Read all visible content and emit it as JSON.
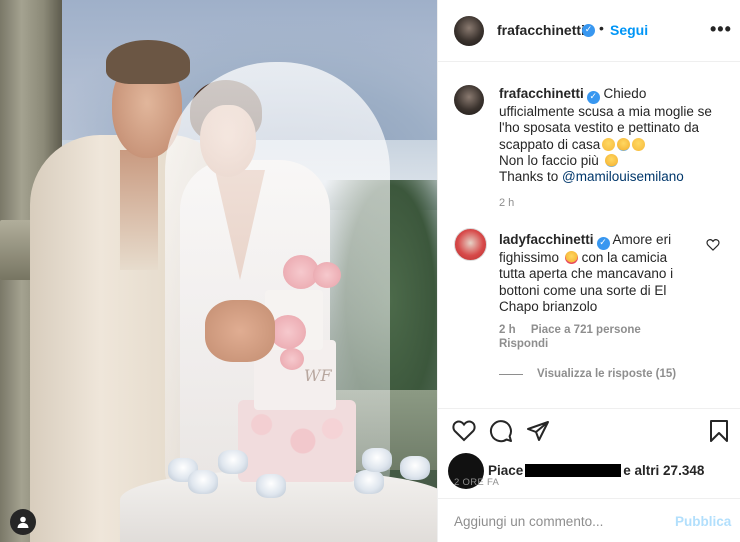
{
  "post": {
    "author": "frafacchinetti",
    "follow_label": "Segui",
    "header_separator": "•",
    "more_label": "•••",
    "image_monogram": "WF"
  },
  "caption": {
    "username": "frafacchinetti",
    "lines": [
      "Chiedo",
      "ufficialmente scusa a mia moglie se",
      "l'ho sposata vestito e pettinato da",
      "scappato di casa",
      "Non lo faccio più",
      "Thanks to"
    ],
    "mention": "@mamilouisemilano",
    "time": "2 h"
  },
  "reply": {
    "username": "ladyfacchinetti",
    "text_1": "Amore eri",
    "text_2": "fighissimo",
    "text_2b": "con la camicia",
    "text_3": "tutta aperta che mancavano i",
    "text_4": "bottoni come una sorte di El",
    "text_5": "Chapo brianzolo",
    "time": "2 h",
    "likes": "Piace a 721 persone",
    "reply_label": "Rispondi",
    "view_replies": "Visualizza le risposte (15)"
  },
  "actions": {
    "likes_prefix": "Piace",
    "likes_suffix": "e altri 27.348",
    "post_time": "2 ORE FA"
  },
  "comment_box": {
    "placeholder": "Aggiungi un commento...",
    "publish_label": "Pubblica"
  },
  "colors": {
    "accent": "#0095f6",
    "verified": "#3897f0",
    "publish_disabled": "#b2dffc",
    "muted": "#8e8e8e"
  },
  "icons": [
    "verified-badge-icon",
    "more-options-icon",
    "heart-icon",
    "comment-icon",
    "share-icon",
    "bookmark-icon",
    "user-tag-icon"
  ]
}
